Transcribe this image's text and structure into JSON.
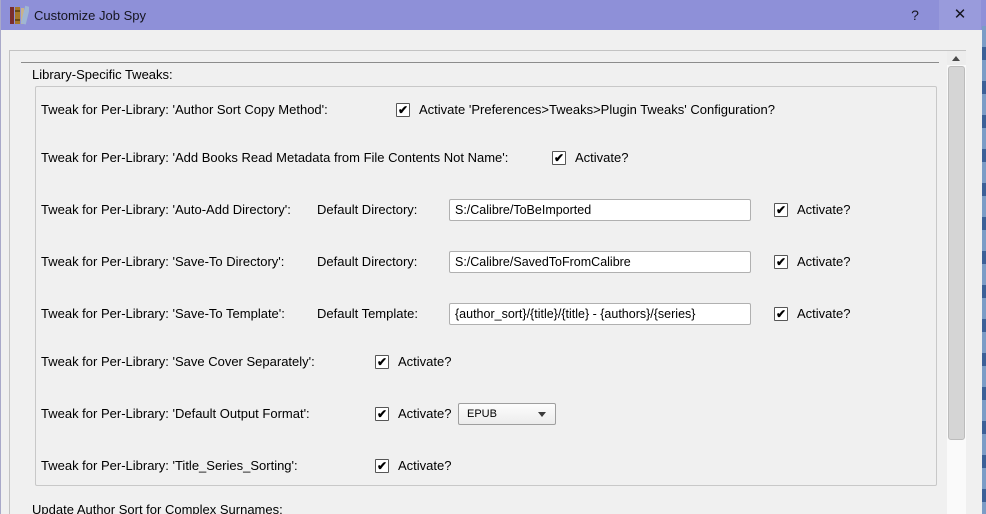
{
  "titlebar": {
    "title": "Customize Job Spy",
    "help_glyph": "?",
    "close_glyph": "✕"
  },
  "glyphs": {
    "check": "✔"
  },
  "headers": {
    "library_tweaks": "Library-Specific Tweaks:",
    "next_section": "Update Author Sort for Complex Surnames:"
  },
  "rows": [
    {
      "label": "Tweak for Per-Library: 'Author Sort Copy Method':",
      "checkbox_label": "Activate 'Preferences>Tweaks>Plugin Tweaks' Configuration?",
      "checked": true
    },
    {
      "label": "Tweak for Per-Library: 'Add Books Read Metadata from File Contents Not Name':",
      "checkbox_label": "Activate?",
      "checked": true
    },
    {
      "label": "Tweak for Per-Library: 'Auto-Add Directory':",
      "field_label": "Default Directory:",
      "field_value": "S:/Calibre/ToBeImported",
      "checkbox_label": "Activate?",
      "checked": true
    },
    {
      "label": "Tweak for Per-Library: 'Save-To Directory':",
      "field_label": "Default Directory:",
      "field_value": "S:/Calibre/SavedToFromCalibre",
      "checkbox_label": "Activate?",
      "checked": true
    },
    {
      "label": "Tweak for Per-Library: 'Save-To Template':",
      "field_label": "Default Template:",
      "field_value": "{author_sort}/{title}/{title} - {authors}/{series}",
      "checkbox_label": "Activate?",
      "checked": true
    },
    {
      "label": "Tweak for Per-Library: 'Save Cover Separately':",
      "checkbox_label": "Activate?",
      "checked": true
    },
    {
      "label": "Tweak for Per-Library: 'Default Output Format':",
      "checkbox_label": "Activate?",
      "checked": true,
      "dropdown_value": "EPUB"
    },
    {
      "label": "Tweak for Per-Library: 'Title_Series_Sorting':",
      "checkbox_label": "Activate?",
      "checked": true
    }
  ],
  "colors": {
    "titlebar_bg": "#8e90d8",
    "dialog_bg": "#f0f0f0",
    "edge_strip_blue": "#7b9cc6",
    "edge_strip_dark_blue": "#3c6097"
  }
}
